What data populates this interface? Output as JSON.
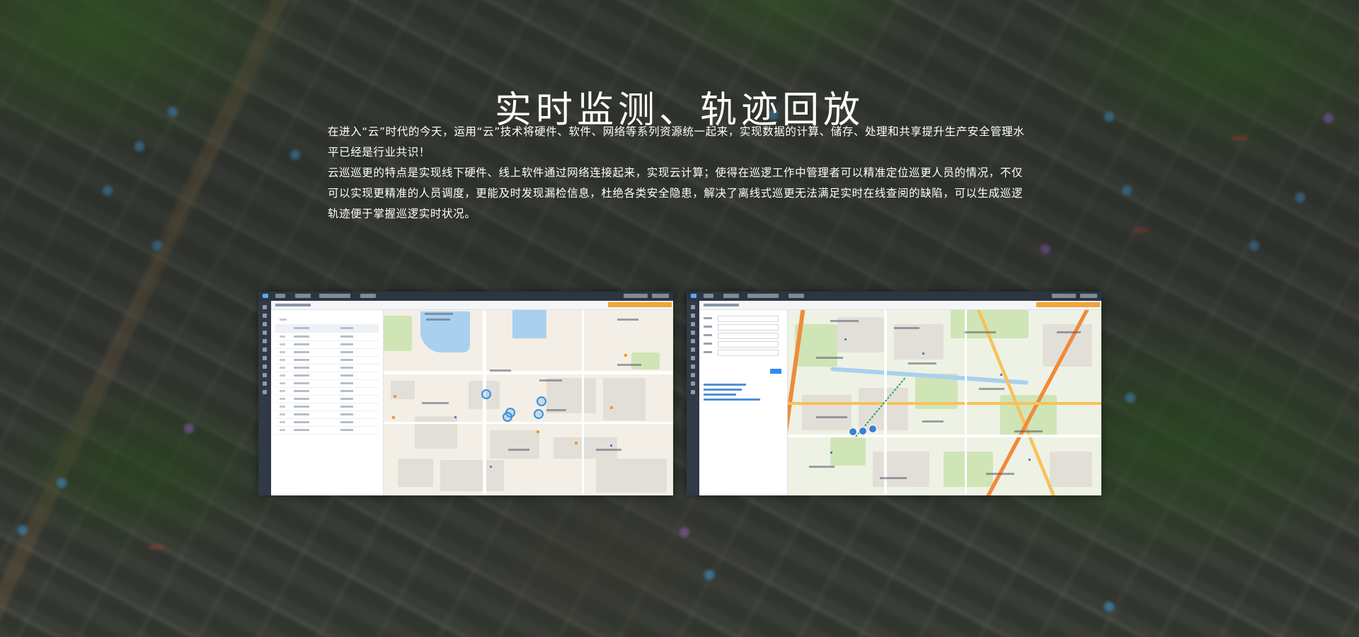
{
  "page": {
    "title": "实时监测、轨迹回放",
    "paragraphs": [
      "在进入“云”时代的今天，运用“云”技术将硬件、软件、网络等系列资源统一起来，实现数据的计算、储存、处理和共享提升生产安全管理水平已经是行业共识！",
      "云巡巡更的特点是实现线下硬件、线上软件通过网络连接起来，实现云计算；使得在巡逻工作中管理者可以精准定位巡更人员的情况，不仅可以实现更精准的人员调度，更能及时发现漏检信息，杜绝各类安全隐患，解决了离线式巡更无法满足实时在线查阅的缺陷，可以生成巡逻轨迹便于掌握巡逻实时状况。"
    ]
  },
  "screenshots": [
    {
      "name": "realtime-monitor-screenshot",
      "view": "map-with-personnel-list"
    },
    {
      "name": "track-playback-screenshot",
      "view": "map-with-route-trail"
    }
  ],
  "colors": {
    "title_text": "#ffffff",
    "app_topbar": "#2c3642",
    "app_sidebar": "#2f3947",
    "alert_bar": "#f0a43a",
    "marker_blue": "#3b8ed8",
    "trail_green": "#22aa55"
  }
}
